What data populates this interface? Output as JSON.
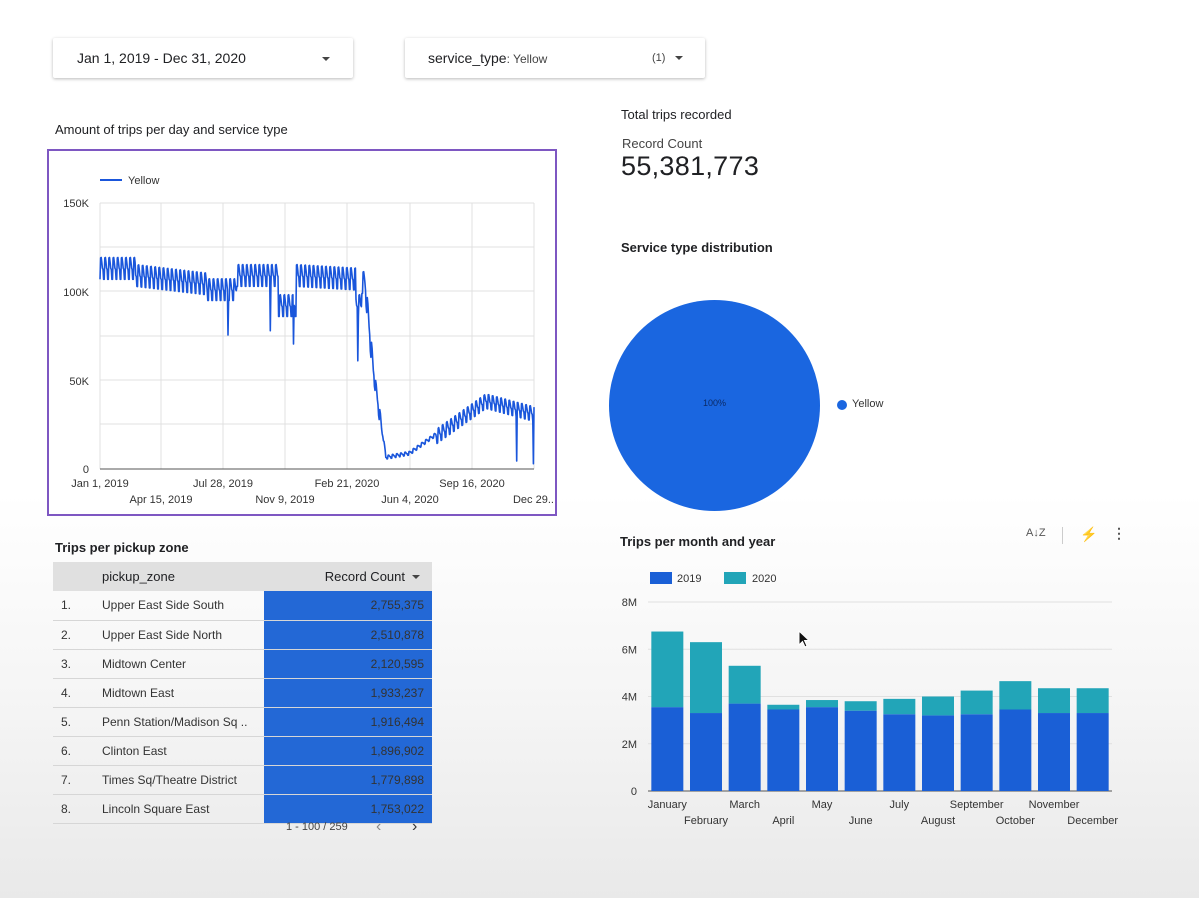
{
  "filters": {
    "date_range": "Jan 1, 2019 - Dec 31, 2020",
    "service_type_key": "service_type",
    "service_type_value": ": Yellow",
    "service_type_count": "(1)"
  },
  "line_chart": {
    "title": "Amount of trips per day and service type",
    "legend": "Yellow",
    "colors": {
      "series": "#1a56db",
      "border": "#7e57c2"
    },
    "y_ticks": [
      "150K",
      "100K",
      "50K",
      "0"
    ],
    "x_ticks_top": [
      "Jan 1, 2019",
      "Jul 28, 2019",
      "Feb 21, 2020",
      "Sep 16, 2020"
    ],
    "x_ticks_bottom": [
      "Apr 15, 2019",
      "Nov 9, 2019",
      "Jun 4, 2020",
      "Dec 29..."
    ]
  },
  "scorecard": {
    "title": "Total trips recorded",
    "label": "Record Count",
    "value": "55,381,773"
  },
  "pie": {
    "title": "Service type distribution",
    "slice_label": "100%",
    "legend": "Yellow",
    "color": "#1a66e0"
  },
  "table": {
    "title": "Trips per pickup zone",
    "col_zone": "pickup_zone",
    "col_count": "Record Count",
    "rows": [
      {
        "rank": "1.",
        "zone": "Upper East Side South",
        "count": "2,755,375"
      },
      {
        "rank": "2.",
        "zone": "Upper East Side North",
        "count": "2,510,878"
      },
      {
        "rank": "3.",
        "zone": "Midtown Center",
        "count": "2,120,595"
      },
      {
        "rank": "4.",
        "zone": "Midtown East",
        "count": "1,933,237"
      },
      {
        "rank": "5.",
        "zone": "Penn Station/Madison Sq ..",
        "count": "1,916,494"
      },
      {
        "rank": "6.",
        "zone": "Clinton East",
        "count": "1,896,902"
      },
      {
        "rank": "7.",
        "zone": "Times Sq/Theatre District",
        "count": "1,779,898"
      },
      {
        "rank": "8.",
        "zone": "Lincoln Square East",
        "count": "1,753,022"
      }
    ],
    "pagination": "1 - 100 / 259"
  },
  "chart_data": {
    "type": "bar",
    "title": "Trips per month and year",
    "categories": [
      "January",
      "February",
      "March",
      "April",
      "May",
      "June",
      "July",
      "August",
      "September",
      "October",
      "November",
      "December"
    ],
    "series": [
      {
        "name": "2019",
        "color": "#1a5fd6",
        "values": [
          3.55,
          3.3,
          3.7,
          3.45,
          3.55,
          3.4,
          3.25,
          3.2,
          3.25,
          3.45,
          3.3,
          3.3
        ]
      },
      {
        "name": "2020",
        "color": "#22a5b8",
        "values": [
          3.2,
          3.0,
          1.6,
          0.2,
          0.3,
          0.4,
          0.65,
          0.8,
          1.0,
          1.2,
          1.05,
          1.05
        ]
      }
    ],
    "stacked": true,
    "y_ticks": [
      "8M",
      "6M",
      "4M",
      "2M",
      "0"
    ],
    "ylim": [
      0,
      8
    ],
    "legend_position": "top-left"
  }
}
